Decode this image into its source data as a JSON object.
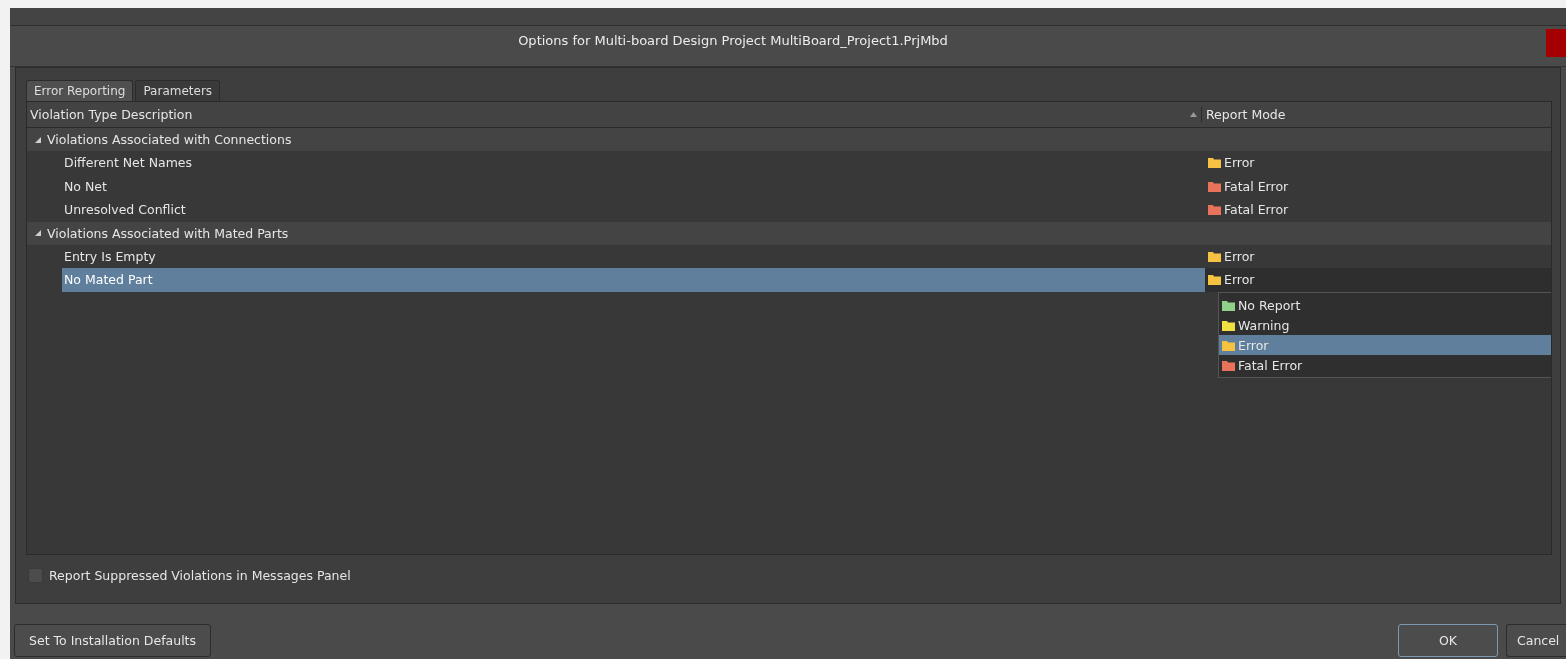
{
  "window": {
    "title": "Options for Multi-board Design Project MultiBoard_Project1.PrjMbd"
  },
  "tabs": [
    {
      "label": "Error Reporting",
      "selected": true
    },
    {
      "label": "Parameters",
      "selected": false
    }
  ],
  "table": {
    "columns": [
      "Violation Type Description",
      "Report Mode"
    ],
    "groups": [
      {
        "label": "Violations Associated with Connections",
        "expanded": true,
        "rows": [
          {
            "name": "Different Net Names",
            "mode": "Error",
            "color": "#f5c242",
            "selected": false
          },
          {
            "name": "No Net",
            "mode": "Fatal Error",
            "color": "#e8735a",
            "selected": false
          },
          {
            "name": "Unresolved Conflict",
            "mode": "Fatal Error",
            "color": "#e8735a",
            "selected": false
          }
        ]
      },
      {
        "label": "Violations Associated with Mated Parts",
        "expanded": true,
        "rows": [
          {
            "name": "Entry Is Empty",
            "mode": "Error",
            "color": "#f5c242",
            "selected": false
          },
          {
            "name": "No Mated Part",
            "mode": "Error",
            "color": "#f5c242",
            "selected": true
          }
        ]
      }
    ]
  },
  "dropdown": {
    "options": [
      {
        "label": "No Report",
        "color": "#8fd18a",
        "selected": false
      },
      {
        "label": "Warning",
        "color": "#f0e040",
        "selected": false
      },
      {
        "label": "Error",
        "color": "#f5c242",
        "selected": true
      },
      {
        "label": "Fatal Error",
        "color": "#e8735a",
        "selected": false
      }
    ]
  },
  "checkbox": {
    "label": "Report Suppressed Violations in Messages Panel",
    "checked": false
  },
  "buttons": [
    {
      "label": "Set To Installation Defaults",
      "kind": "left"
    },
    {
      "label": "OK",
      "kind": "default"
    },
    {
      "label": "Cancel",
      "kind": "normal"
    }
  ]
}
